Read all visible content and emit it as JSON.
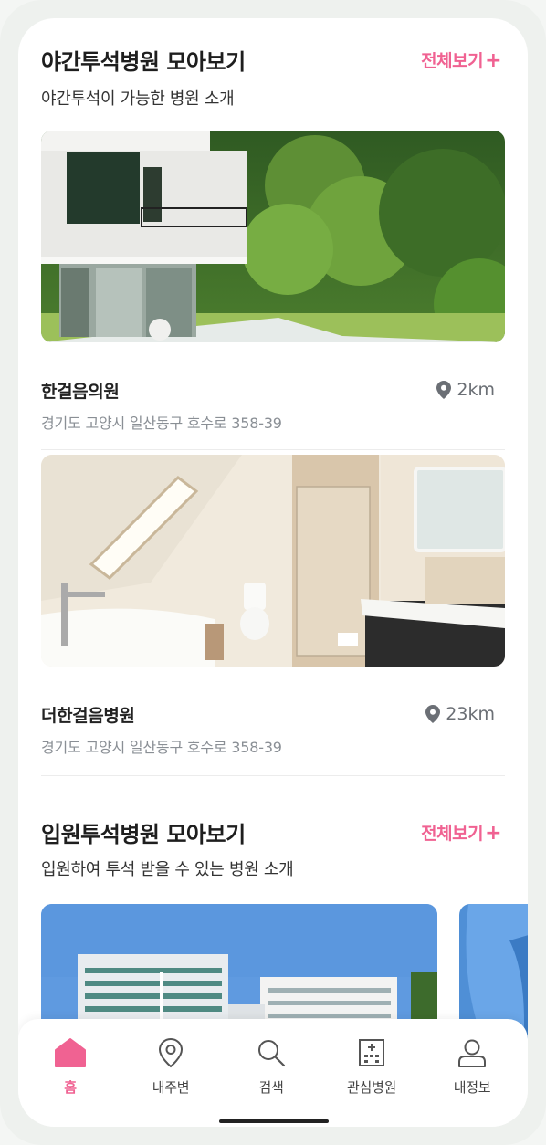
{
  "night_section": {
    "title": "야간투석병원 모아보기",
    "see_all": "전체보기",
    "see_all_icon": "plus-icon",
    "subtitle": "야간투석이 가능한 병원 소개",
    "hospitals": [
      {
        "name": "한걸음의원",
        "distance": "2km",
        "address": "경기도 고양시 일산동구 호수로 358-39",
        "image": "modern-house-with-trees-photo"
      },
      {
        "name": "더한걸음병원",
        "distance": "23km",
        "address": "경기도 고양시 일산동구 호수로 358-39",
        "image": "bathroom-interior-photo"
      }
    ]
  },
  "inpatient_section": {
    "title": "입원투석병원 모아보기",
    "see_all": "전체보기",
    "see_all_icon": "plus-icon",
    "subtitle": "입원하여 투석 받을 수 있는 병원 소개",
    "cards": [
      {
        "image": "hospital-building-photo"
      },
      {
        "image": "medical-staff-photo"
      }
    ]
  },
  "tabbar": {
    "tabs": [
      {
        "label": "홈",
        "icon": "home-icon",
        "active": true
      },
      {
        "label": "내주변",
        "icon": "location-pin-icon",
        "active": false
      },
      {
        "label": "검색",
        "icon": "search-icon",
        "active": false
      },
      {
        "label": "관심병원",
        "icon": "hospital-building-icon",
        "active": false
      },
      {
        "label": "내정보",
        "icon": "user-icon",
        "active": false
      }
    ]
  },
  "colors": {
    "accent": "#f06292",
    "text": "#222222",
    "muted": "#8a8f95"
  }
}
